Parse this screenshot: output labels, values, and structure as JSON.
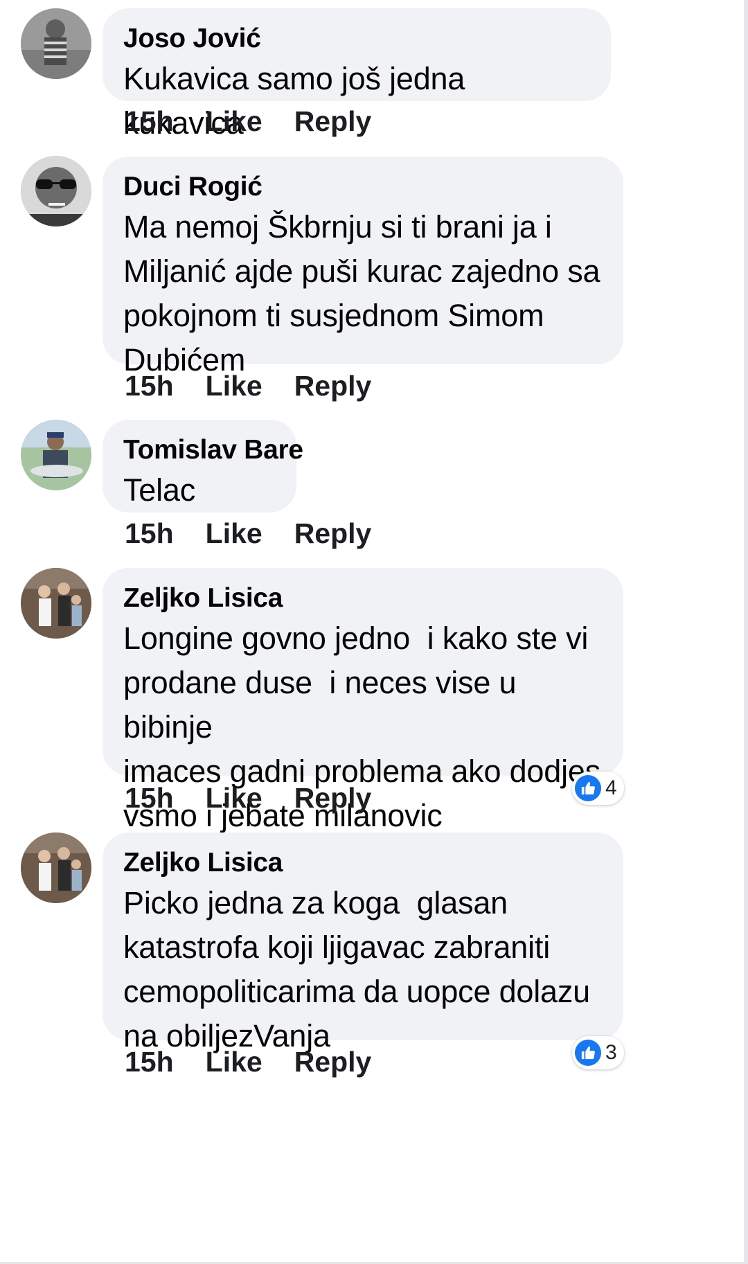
{
  "comments": [
    {
      "author": "Joso Jović",
      "text": "Kukavica samo još jedna kukavica",
      "time": "15h",
      "like_label": "Like",
      "reply_label": "Reply"
    },
    {
      "author": "Duci Rogić",
      "text": "Ma nemoj Škbrnju si ti brani ja i\nMiljanić ajde puši kurac zajedno sa\npokojnom ti susjednom Simom\nDubićem",
      "time": "15h",
      "like_label": "Like",
      "reply_label": "Reply"
    },
    {
      "author": "Tomislav Bare",
      "text": "Telac",
      "time": "15h",
      "like_label": "Like",
      "reply_label": "Reply"
    },
    {
      "author": "Zeljko Lisica",
      "text": "Longine govno jedno  i kako ste vi\nprodane duse  i neces vise u bibinje\nimaces gadni problema ako dodjes\nvsmo i jebate milanovic",
      "time": "15h",
      "like_label": "Like",
      "reply_label": "Reply",
      "reaction_count": "4"
    },
    {
      "author": "Zeljko Lisica",
      "text": "Picko jedna za koga  glasan\nkatastrofa koji ljigavac zabraniti\ncemopoliticarima da uopce dolazu\nna obiljezVanja",
      "time": "15h",
      "like_label": "Like",
      "reply_label": "Reply",
      "reaction_count": "3"
    }
  ],
  "colors": {
    "bubble": "#f0f2f5",
    "like_blue": "#1877f2",
    "text": "#050505"
  },
  "icons": {
    "reaction": "thumbs-up-icon"
  }
}
